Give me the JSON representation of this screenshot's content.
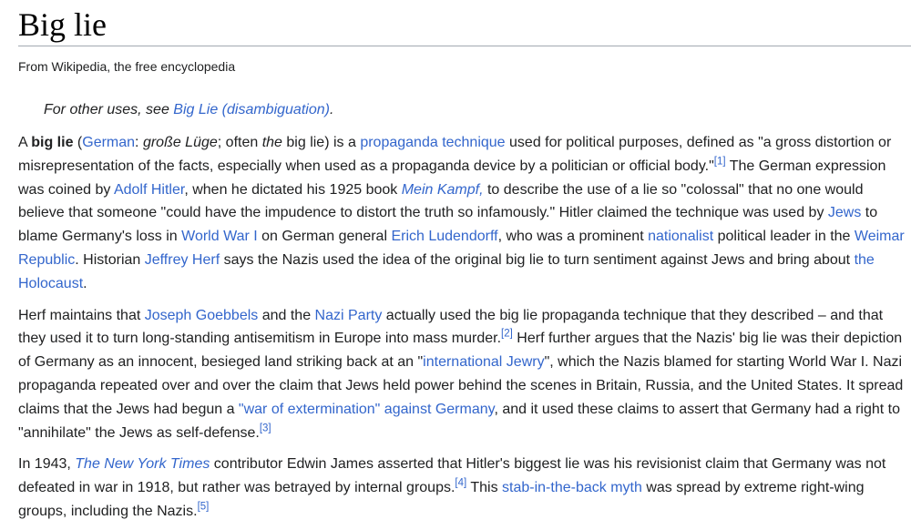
{
  "header": {
    "title": "Big lie",
    "tagline": "From Wikipedia, the free encyclopedia"
  },
  "hatnote": {
    "prefix": "For other uses, see ",
    "link": "Big Lie (disambiguation)",
    "suffix": "."
  },
  "paragraphs": [
    {
      "segments": [
        {
          "t": "A "
        },
        {
          "t": "big lie",
          "bold": true
        },
        {
          "t": " ("
        },
        {
          "t": "German",
          "link": true
        },
        {
          "t": ": "
        },
        {
          "t": "große Lüge",
          "italic": true
        },
        {
          "t": "; often "
        },
        {
          "t": "the",
          "italic": true
        },
        {
          "t": " big lie) is a "
        },
        {
          "t": "propaganda technique",
          "link": true
        },
        {
          "t": " used for political purposes, defined as \"a gross distortion or misrepresentation of the facts, especially when used as a propaganda device by a politician or official body.\""
        },
        {
          "t": "[1]",
          "sup": true,
          "link": true
        },
        {
          "t": " The German expression was coined by "
        },
        {
          "t": "Adolf Hitler",
          "link": true
        },
        {
          "t": ", when he dictated his 1925 book "
        },
        {
          "t": "Mein Kampf,",
          "link": true,
          "italic": true
        },
        {
          "t": " to describe the use of a lie so \"colossal\" that no one would believe that someone \"could have the impudence to distort the truth so infamously.\" Hitler claimed the technique was used by "
        },
        {
          "t": "Jews",
          "link": true
        },
        {
          "t": " to blame Germany's loss in "
        },
        {
          "t": "World War I",
          "link": true
        },
        {
          "t": " on German general "
        },
        {
          "t": "Erich Ludendorff",
          "link": true
        },
        {
          "t": ", who was a prominent "
        },
        {
          "t": "nationalist",
          "link": true
        },
        {
          "t": " political leader in the "
        },
        {
          "t": "Weimar Republic",
          "link": true
        },
        {
          "t": ". Historian "
        },
        {
          "t": "Jeffrey Herf",
          "link": true
        },
        {
          "t": " says the Nazis used the idea of the original big lie to turn sentiment against Jews and bring about "
        },
        {
          "t": "the Holocaust",
          "link": true
        },
        {
          "t": "."
        }
      ]
    },
    {
      "segments": [
        {
          "t": "Herf maintains that "
        },
        {
          "t": "Joseph Goebbels",
          "link": true
        },
        {
          "t": " and the "
        },
        {
          "t": "Nazi Party",
          "link": true
        },
        {
          "t": " actually used the big lie propaganda technique that they described – and that they used it to turn long-standing antisemitism in Europe into mass murder."
        },
        {
          "t": "[2]",
          "sup": true,
          "link": true
        },
        {
          "t": " Herf further argues that the Nazis' big lie was their depiction of Germany as an innocent, besieged land striking back at an \""
        },
        {
          "t": "international Jewry",
          "link": true
        },
        {
          "t": "\", which the Nazis blamed for starting World War I. Nazi propaganda repeated over and over the claim that Jews held power behind the scenes in Britain, Russia, and the United States. It spread claims that the Jews had begun a "
        },
        {
          "t": "\"war of extermination\" against Germany",
          "link": true
        },
        {
          "t": ", and it used these claims to assert that Germany had a right to \"annihilate\" the Jews as self-defense."
        },
        {
          "t": "[3]",
          "sup": true,
          "link": true
        }
      ]
    },
    {
      "segments": [
        {
          "t": "In 1943, "
        },
        {
          "t": "The New York Times",
          "link": true,
          "italic": true
        },
        {
          "t": " contributor Edwin James asserted that Hitler's biggest lie was his revisionist claim that Germany was not defeated in war in 1918, but rather was betrayed by internal groups."
        },
        {
          "t": "[4]",
          "sup": true,
          "link": true
        },
        {
          "t": " This "
        },
        {
          "t": "stab-in-the-back myth",
          "link": true
        },
        {
          "t": " was spread by extreme right-wing groups, including the Nazis."
        },
        {
          "t": "[5]",
          "sup": true,
          "link": true
        }
      ]
    }
  ],
  "colors": {
    "text": "#202122",
    "link": "#3366cc",
    "rule": "#a2a9b1",
    "title": "#000000"
  }
}
